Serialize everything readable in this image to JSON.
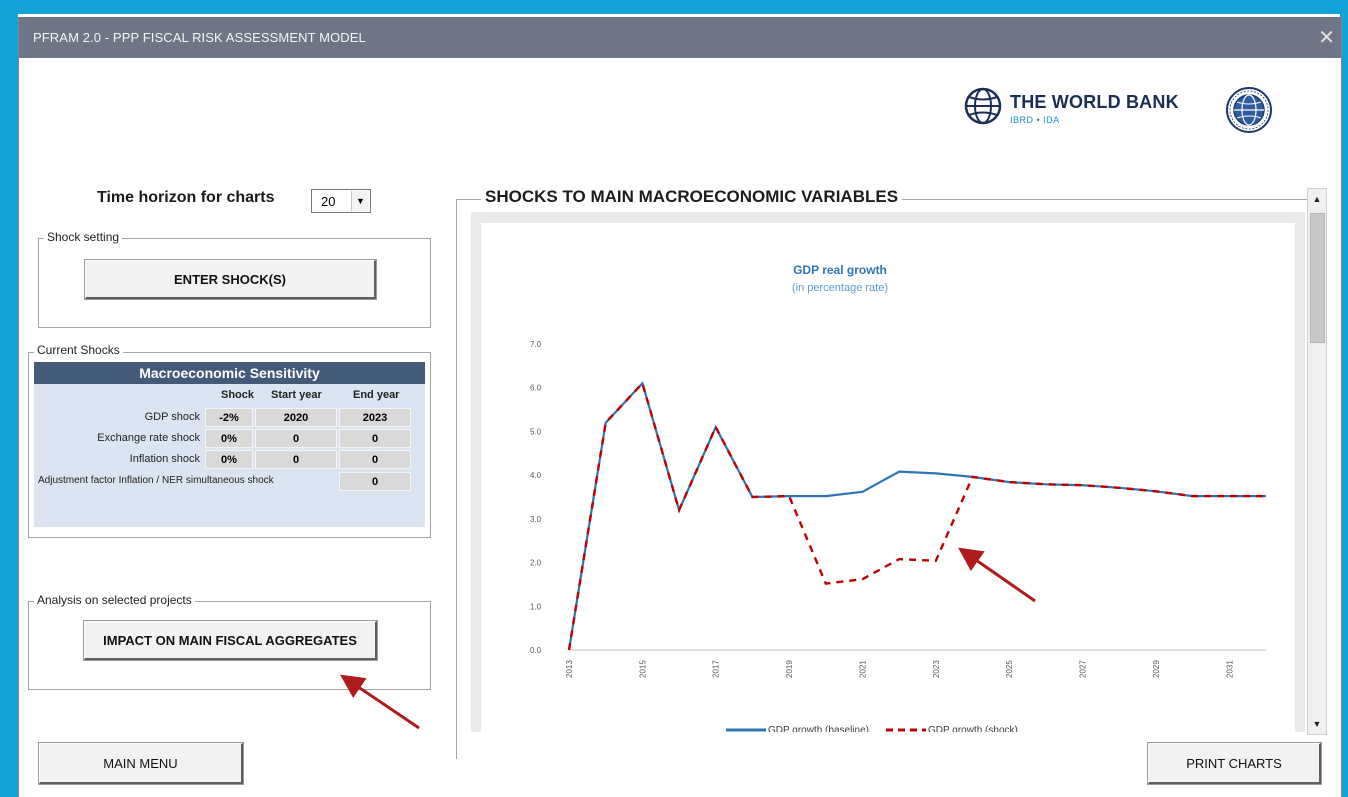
{
  "window": {
    "title": "PFRAM 2.0 - PPP FISCAL RISK ASSESSMENT MODEL",
    "close_glyph": "✕"
  },
  "logos": {
    "world_bank_name": "THE WORLD BANK",
    "world_bank_sub": "IBRD • IDA"
  },
  "time_horizon": {
    "label": "Time horizon for charts",
    "value": "20"
  },
  "shock_setting": {
    "legend": "Shock setting",
    "button": "ENTER SHOCK(S)"
  },
  "current_shocks": {
    "legend": "Current Shocks",
    "table_title": "Macroeconomic Sensitivity",
    "columns": [
      "Shock",
      "Start year",
      "End year"
    ],
    "rows": [
      {
        "label": "GDP shock",
        "shock": "-2%",
        "start": "2020",
        "end": "2023"
      },
      {
        "label": "Exchange rate shock",
        "shock": "0%",
        "start": "0",
        "end": "0"
      },
      {
        "label": "Inflation shock",
        "shock": "0%",
        "start": "0",
        "end": "0"
      }
    ],
    "adjustment": {
      "label": "Adjustment factor Inflation / NER simultaneous shock",
      "value": "0"
    }
  },
  "analysis": {
    "legend": "Analysis on selected projects",
    "button": "IMPACT ON MAIN FISCAL AGGREGATES"
  },
  "buttons": {
    "main_menu": "MAIN MENU",
    "print_charts": "PRINT CHARTS"
  },
  "chart_section": {
    "title": "SHOCKS TO MAIN MACROECONOMIC VARIABLES"
  },
  "colors": {
    "baseline": "#2e75b6",
    "shock": "#c00000",
    "arrow": "#b01c1c",
    "header": "#435a7a"
  },
  "chart_data": {
    "type": "line",
    "title": "GDP real growth",
    "subtitle": "(in percentage rate)",
    "x": [
      2013,
      2014,
      2015,
      2016,
      2017,
      2018,
      2019,
      2020,
      2021,
      2022,
      2023,
      2024,
      2025,
      2026,
      2027,
      2028,
      2029,
      2030,
      2031,
      2032
    ],
    "x_tick_labels": [
      "2013",
      "2015",
      "2017",
      "2019",
      "2021",
      "2023",
      "2025",
      "2027",
      "2029",
      "2031"
    ],
    "ylim": [
      0,
      7
    ],
    "y_tick_labels": [
      "0.0",
      "1.0",
      "2.0",
      "3.0",
      "4.0",
      "5.0",
      "6.0",
      "7.0"
    ],
    "series": [
      {
        "name": "GDP growth (baseline)",
        "values": [
          0.0,
          5.2,
          6.1,
          3.2,
          5.1,
          3.5,
          3.52,
          3.52,
          3.62,
          4.08,
          4.04,
          3.96,
          3.84,
          3.79,
          3.77,
          3.71,
          3.63,
          3.52,
          3.52,
          3.52
        ]
      },
      {
        "name": "GDP growth (shock)",
        "values": [
          0.0,
          5.2,
          6.1,
          3.2,
          5.1,
          3.5,
          3.52,
          1.52,
          1.62,
          2.08,
          2.04,
          3.96,
          3.84,
          3.79,
          3.77,
          3.71,
          3.63,
          3.52,
          3.52,
          3.52
        ]
      }
    ],
    "grid": false,
    "legend_position": "bottom"
  }
}
